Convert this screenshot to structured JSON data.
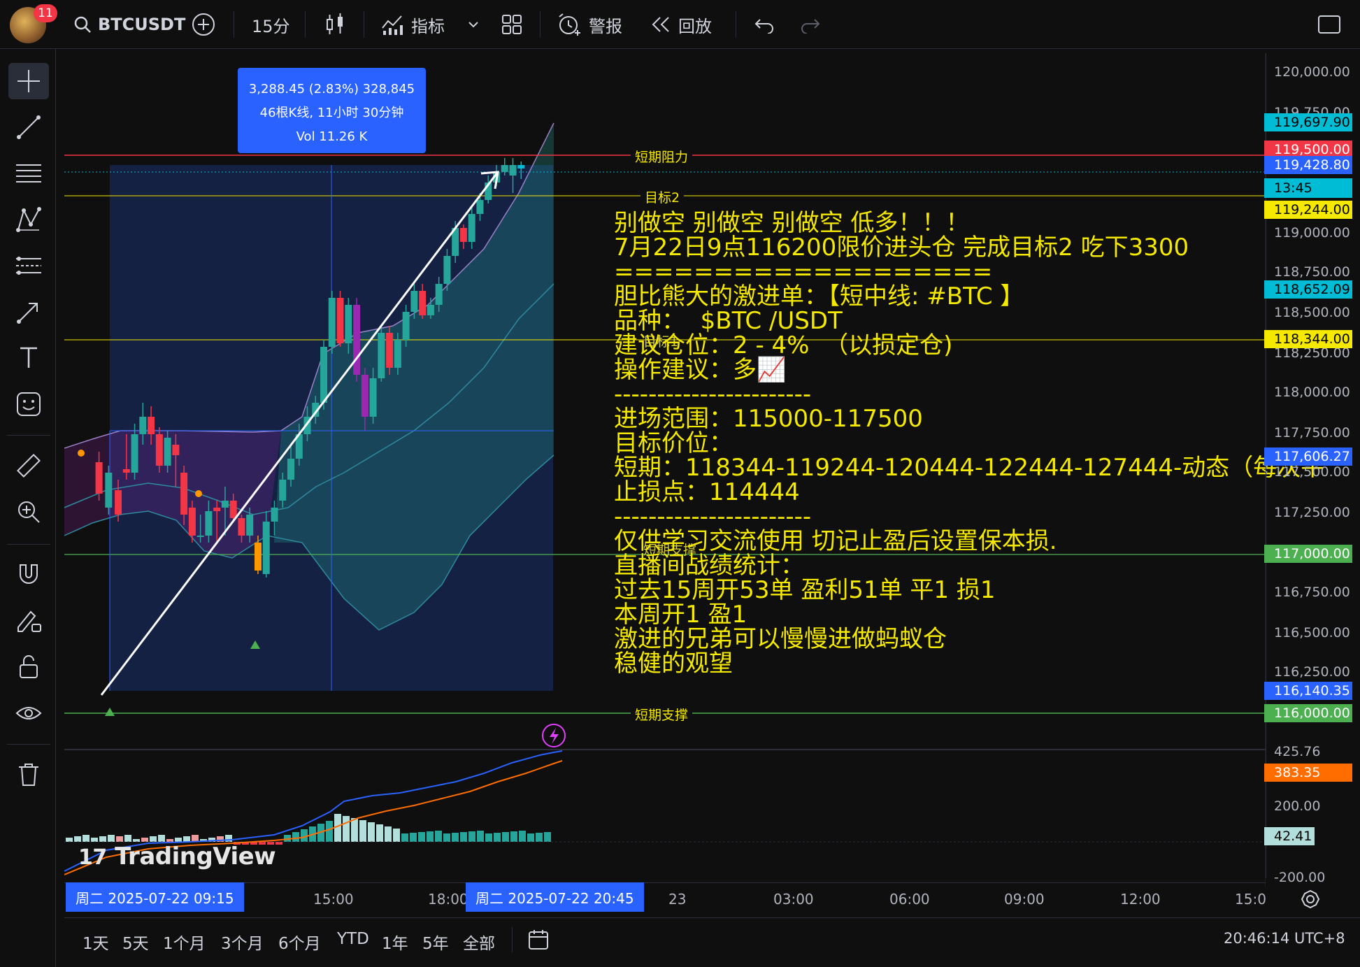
{
  "header": {
    "notification_count": "11",
    "symbol": "BTCUSDT",
    "interval": "15分",
    "indicators_label": "指标",
    "alerts_label": "警报",
    "replay_label": "回放"
  },
  "measure": {
    "line1": "3,288.45 (2.83%) 328,845",
    "line2": "46根K线, 11小时 30分钟",
    "line3": "Vol 11.26 K"
  },
  "lines": {
    "resistance_label": "短期阻力",
    "target2_label": "目标2",
    "support_label": "短期支撑",
    "target1_label": "目标1",
    "support_mid_label": "短期支撑"
  },
  "overlay_text": "别做空 别做空 别做空 低多！！！\n7月22日9点116200限价进头仓 完成目标2 吃下3300\n===================\n胆比熊大的激进单：【短中线: #BTC 】\n品种：  $BTC /USDT\n建议仓位：2 - 4%  （以损定仓)\n操作建议：多📈\n-----------------------\n进场范围：115000-117500\n目标价位：\n短期：118344-119244-120444-122444-127444-动态（每次平\n止损点：114444\n-----------------------\n仅供学习交流使用 切记止盈后设置保本损.\n直播间战绩统计：\n过去15周开53单 盈利51单 平1 损1\n本周开1 盈1\n激进的兄弟可以慢慢进做蚂蚁仓\n稳健的观望",
  "price_axis": {
    "labels": [
      "120,000.00",
      "119,750.00",
      "119,000.00",
      "118,750.00",
      "118,500.00",
      "118,250.00",
      "118,000.00",
      "117,750.00",
      "117,500.00",
      "117,250.00",
      "116,750.00",
      "116,500.00",
      "116,250.00",
      "200.00",
      "-200.00",
      "425.76"
    ],
    "tags": {
      "t1": "119,697.90",
      "t2": "119,500.00",
      "t3": "119,428.80",
      "t4": "13:45",
      "t5": "119,244.00",
      "t6": "118,652.09",
      "t7": "118,344.00",
      "t8": "117,606.27",
      "t9": "117,000.00",
      "t10": "116,140.35",
      "t11": "116,000.00",
      "t12": "383.35",
      "t13": "42.41"
    },
    "colors": {
      "cyan": "#00bcd4",
      "red": "#f23645",
      "blue": "#2962ff",
      "yellow": "#f5e900",
      "green": "#4caf50",
      "orange": "#ff6d00"
    }
  },
  "time_axis": {
    "start_tag": "周二 2025-07-22   09:15",
    "end_tag": "周二 2025-07-22   20:45",
    "labels": [
      "15:00",
      "18:00",
      "23",
      "03:00",
      "06:00",
      "09:00",
      "12:00",
      "15:0"
    ]
  },
  "ranges": [
    "1天",
    "5天",
    "1个月",
    "3个月",
    "6个月",
    "YTD",
    "1年",
    "5年",
    "全部"
  ],
  "clock": "20:46:14 UTC+8",
  "watermark": "TradingView"
}
